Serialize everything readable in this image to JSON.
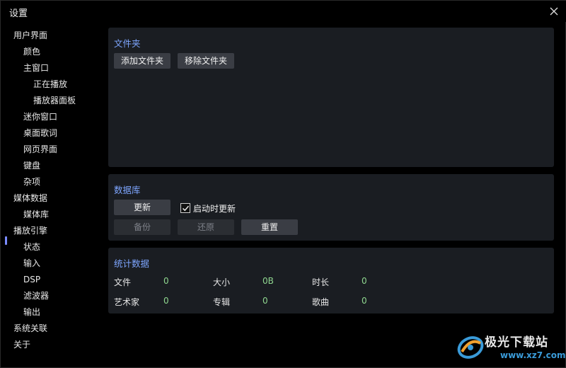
{
  "window": {
    "title": "设置"
  },
  "sidebar": {
    "items": [
      {
        "label": "用户界面"
      },
      {
        "label": "颜色"
      },
      {
        "label": "主窗口"
      },
      {
        "label": "正在播放"
      },
      {
        "label": "播放器面板"
      },
      {
        "label": "迷你窗口"
      },
      {
        "label": "桌面歌词"
      },
      {
        "label": "网页界面"
      },
      {
        "label": "键盘"
      },
      {
        "label": "杂项"
      },
      {
        "label": "媒体数据"
      },
      {
        "label": "媒体库"
      },
      {
        "label": "播放引擎"
      },
      {
        "label": "状态"
      },
      {
        "label": "输入"
      },
      {
        "label": "DSP"
      },
      {
        "label": "滤波器"
      },
      {
        "label": "输出"
      },
      {
        "label": "系统关联"
      },
      {
        "label": "关于"
      }
    ],
    "selected": "媒体库"
  },
  "folders": {
    "title": "文件夹",
    "add_label": "添加文件夹",
    "remove_label": "移除文件夹"
  },
  "database": {
    "title": "数据库",
    "update_label": "更新",
    "update_on_start_label": "启动时更新",
    "update_on_start_checked": true,
    "backup_label": "备份",
    "restore_label": "还原",
    "reset_label": "重置"
  },
  "stats": {
    "title": "统计数据",
    "files_label": "文件",
    "files_value": "0",
    "size_label": "大小",
    "size_value": "0B",
    "duration_label": "时长",
    "duration_value": "0",
    "artists_label": "艺术家",
    "artists_value": "0",
    "albums_label": "专辑",
    "albums_value": "0",
    "songs_label": "歌曲",
    "songs_value": "0"
  },
  "watermark": {
    "text": "极光下载站",
    "url": "www.xz7.com"
  },
  "colors": {
    "accent": "#7ea6ff",
    "value": "#8fd68f",
    "panel": "#1a1d22",
    "button": "#3a3d44"
  }
}
